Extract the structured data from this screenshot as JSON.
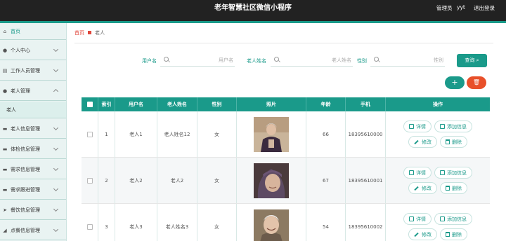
{
  "header": {
    "title": "老年智慧社区微信小程序",
    "role": "管理员",
    "user": "yyt",
    "logout": "退出登录"
  },
  "sidebar": {
    "items": [
      {
        "label": "首页",
        "icon": "home-icon",
        "expandable": false
      },
      {
        "label": "个人中心",
        "icon": "user-icon",
        "expandable": true
      },
      {
        "label": "工作人员管理",
        "icon": "staff-icon",
        "expandable": true
      },
      {
        "label": "老人管理",
        "icon": "elder-icon",
        "expandable": true,
        "expanded": true
      },
      {
        "label": "老人",
        "submenu": true
      },
      {
        "label": "老人信息管理",
        "icon": "info-icon",
        "expandable": true
      },
      {
        "label": "体检信息管理",
        "icon": "health-icon",
        "expandable": true
      },
      {
        "label": "需求信息管理",
        "icon": "demand-icon",
        "expandable": true
      },
      {
        "label": "需求跟进管理",
        "icon": "follow-icon",
        "expandable": true
      },
      {
        "label": "餐饮信息管理",
        "icon": "meal-icon",
        "expandable": true
      },
      {
        "label": "点餐信息管理",
        "icon": "order-icon",
        "expandable": true
      }
    ]
  },
  "breadcrumb": {
    "home": "首页",
    "current": "老人"
  },
  "search": {
    "username_label": "用户名",
    "username_placeholder": "用户名",
    "name_label": "老人姓名",
    "name_placeholder": "老人姓名",
    "gender_label": "性别",
    "gender_placeholder": "性别",
    "query_button": "查询"
  },
  "actions": {
    "add_symbol": "+",
    "delete_symbol": "🗑"
  },
  "table": {
    "headers": [
      "索引",
      "用户名",
      "老人姓名",
      "性别",
      "照片",
      "年龄",
      "手机",
      "操作"
    ],
    "rows": [
      {
        "index": "1",
        "username": "老人1",
        "name": "老人姓名12",
        "gender": "女",
        "age": "66",
        "phone": "18395610000"
      },
      {
        "index": "2",
        "username": "老人2",
        "name": "老人2",
        "gender": "女",
        "age": "67",
        "phone": "18395610001"
      },
      {
        "index": "3",
        "username": "老人3",
        "name": "老人姓名3",
        "gender": "女",
        "age": "54",
        "phone": "18395610002"
      }
    ],
    "op_labels": {
      "detail": "详情",
      "add_info": "添加信息",
      "edit": "修改",
      "delete": "删除"
    }
  },
  "colors": {
    "accent": "#1a9a8a",
    "danger": "#e8502a",
    "header_bg": "#222222"
  }
}
